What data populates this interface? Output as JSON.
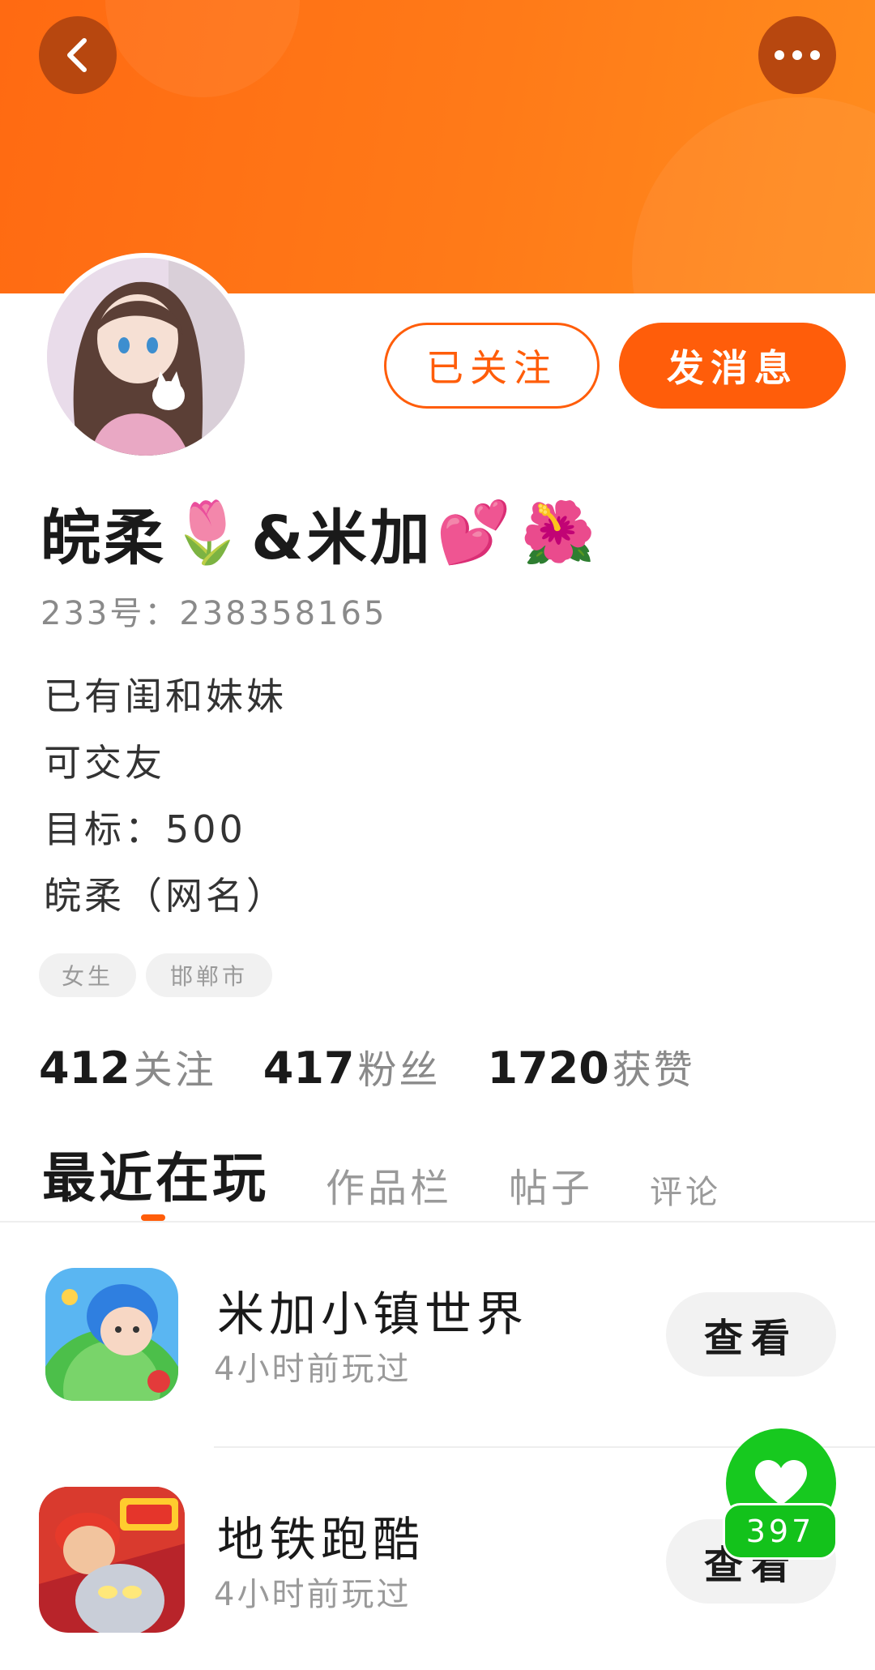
{
  "header": {
    "brand_color": "#ff6a12",
    "back_icon": "chevron-left-icon",
    "more_icon": "more-dots-icon"
  },
  "profile": {
    "actions": {
      "follow_label": "已关注",
      "message_label": "发消息"
    },
    "nickname_parts": [
      "皖柔",
      "🌷",
      "&米加",
      "💕",
      "🌺"
    ],
    "user_id": "233号：238358165",
    "bio": [
      "已有闺和妹妹",
      "可交友",
      "目标：500",
      "皖柔（网名）"
    ],
    "tags": [
      "女生",
      "邯郸市"
    ],
    "stats": [
      {
        "value": "412",
        "label": "关注"
      },
      {
        "value": "417",
        "label": "粉丝"
      },
      {
        "value": "1720",
        "label": "获赞"
      }
    ]
  },
  "tabs": [
    "最近在玩",
    "作品栏",
    "帖子",
    "评论"
  ],
  "active_tab": "最近在玩",
  "games": [
    {
      "name": "米加小镇世界",
      "last_played": "4小时前玩过",
      "action": "查看",
      "icon": "miga-town-icon"
    },
    {
      "name": "地铁跑酷",
      "last_played": "4小时前玩过",
      "action": "查看",
      "icon": "subway-surfers-icon"
    }
  ],
  "floating_like": {
    "count": "397",
    "icon": "heart-icon",
    "color": "#17c91f"
  },
  "accent_color": "#ff5d0a"
}
